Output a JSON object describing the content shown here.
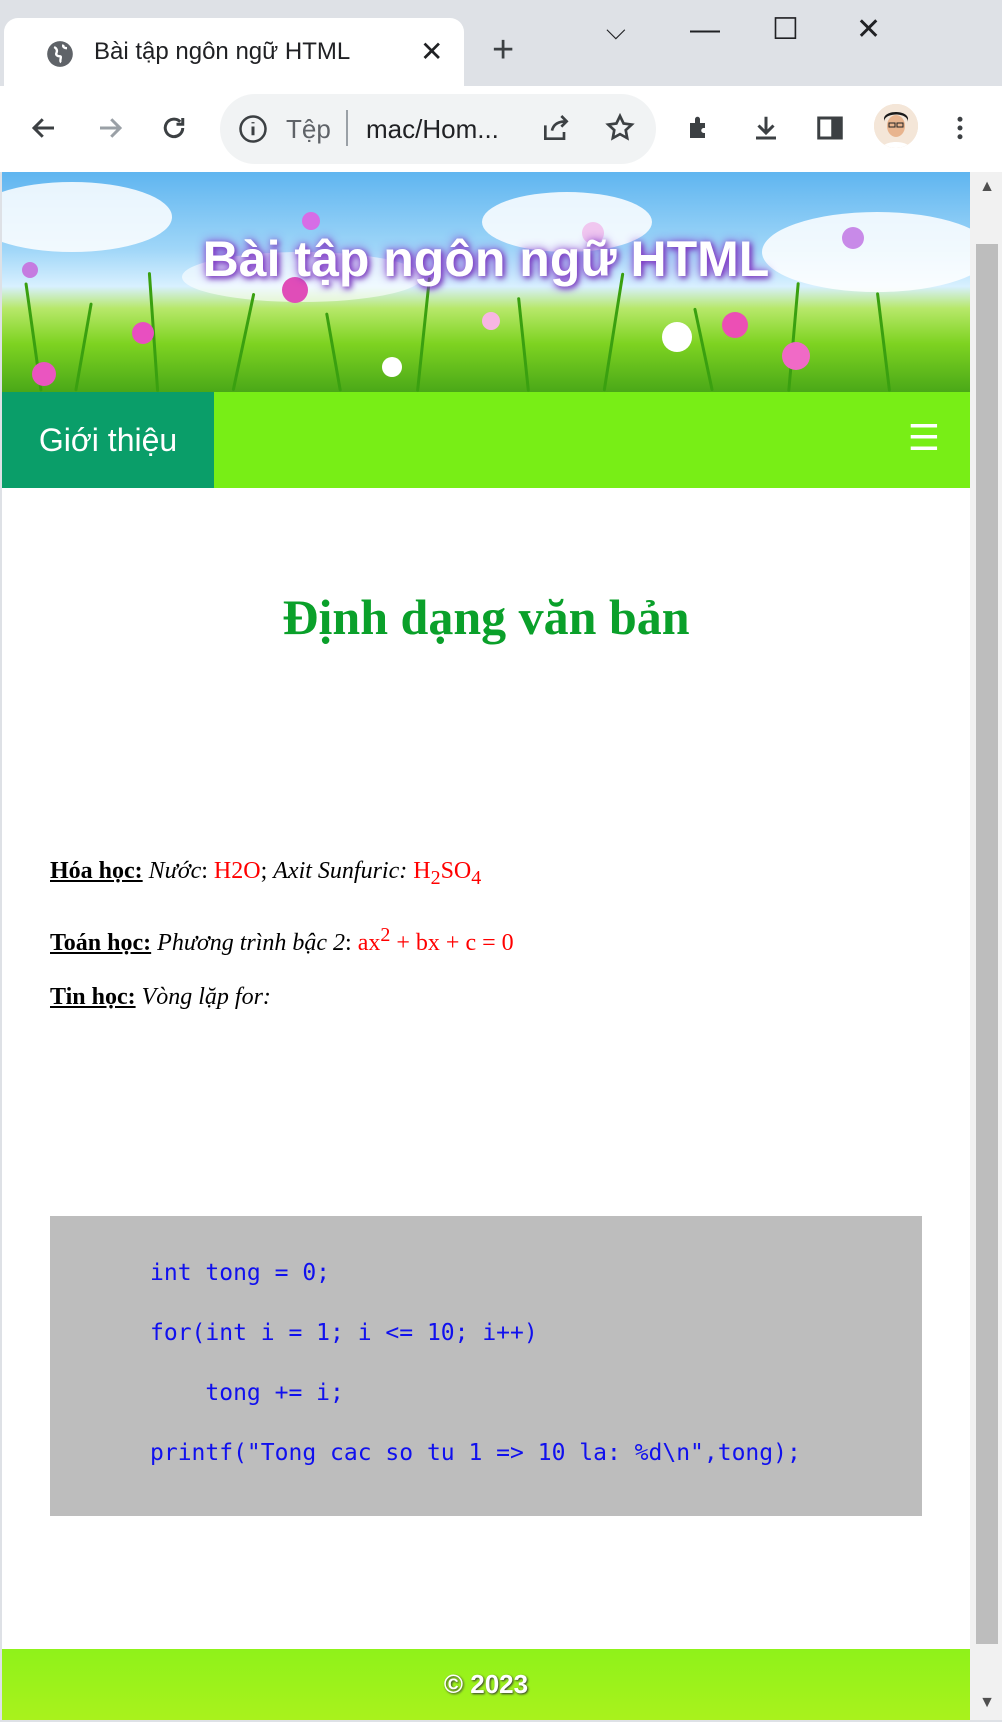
{
  "browser": {
    "tab_title": "Bài tập ngôn ngữ HTML",
    "tab_close": "✕",
    "new_tab": "+",
    "window_controls": {
      "tab_search": "⌵",
      "minimize": "—",
      "maximize": "☐",
      "close": "✕"
    },
    "address_scheme": "Tệp",
    "address_url": "mac/Hom...",
    "icons": [
      "back-icon",
      "forward-icon",
      "reload-icon",
      "info-icon",
      "share-icon",
      "star-icon",
      "extensions-icon",
      "download-icon",
      "side-panel-icon",
      "profile-avatar",
      "more-menu-icon"
    ]
  },
  "page": {
    "banner_title": "Bài tập ngôn ngữ HTML",
    "nav": {
      "item": "Giới thiệu",
      "menu_icon": "☰"
    },
    "heading": "Định dạng văn bản",
    "chem": {
      "label": "Hóa học:",
      "water_label": "Nước",
      "colon1": ": ",
      "water_formula": "H2O",
      "semicolon": "; ",
      "acid_label": "Axit Sunfuric",
      "colon2": ": ",
      "acid_h": "H",
      "acid_h_sub": "2",
      "acid_so": "SO",
      "acid_so_sub": "4"
    },
    "math": {
      "label": "Toán học:",
      "eq_label": "Phương trình bậc 2",
      "colon": ": ",
      "ax": "ax",
      "ax_sup": "2",
      "rest": " + bx + c = 0"
    },
    "info": {
      "label": "Tin học:",
      "loop_label": "Vòng lặp for:"
    },
    "code_lines": [
      "int tong = 0;",
      "for(int i = 1; i <= 10; i++)",
      "\ttong += i;",
      "printf(\"Tong cac so tu 1 => 10 la: %d\\n\",tong);"
    ],
    "footer": "© 2023"
  },
  "colors": {
    "nav_bg": "#78ee16",
    "nav_active": "#0a9e69",
    "heading": "#0aa02a",
    "code_bg": "#bdbdbd",
    "code_text": "#1010ee",
    "accent_red": "#ff0000"
  }
}
